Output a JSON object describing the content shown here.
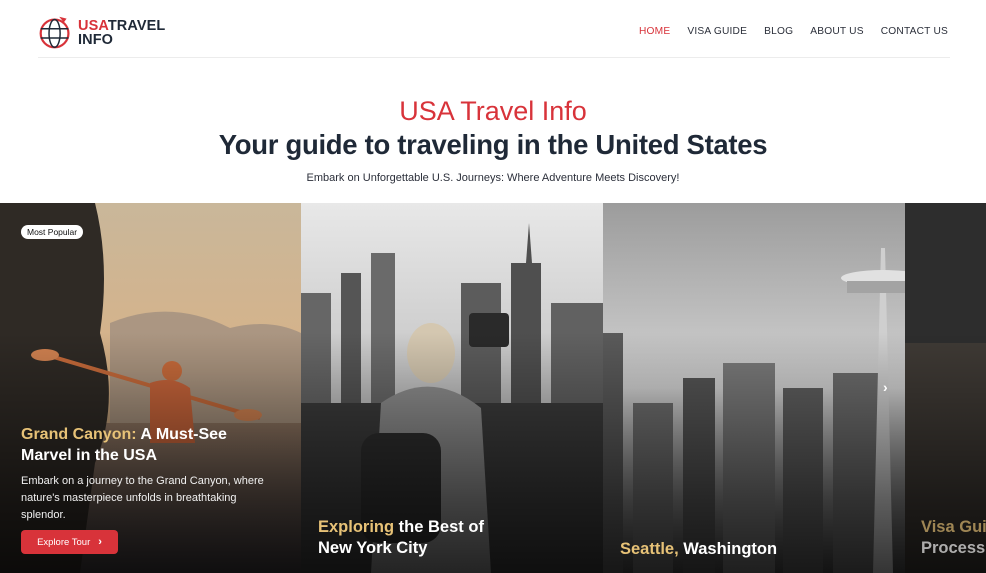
{
  "brand": {
    "name_red": "USA",
    "name_dark": "TRAVEL",
    "name_line2": "INFO"
  },
  "nav": {
    "items": [
      {
        "label": "HOME",
        "active": true
      },
      {
        "label": "VISA GUIDE",
        "active": false
      },
      {
        "label": "BLOG",
        "active": false
      },
      {
        "label": "ABOUT US",
        "active": false
      },
      {
        "label": "CONTACT US",
        "active": false
      }
    ]
  },
  "hero": {
    "title": "USA Travel Info",
    "subtitle": "Your guide to traveling in the United States",
    "tagline": "Embark on Unforgettable U.S. Journeys: Where Adventure Meets Discovery!"
  },
  "cards": [
    {
      "badge": "Most Popular",
      "title_highlight": "Grand Canyon:",
      "title_rest": " A Must-See Marvel in the USA",
      "description": "Embark on a journey to the Grand Canyon, where nature's masterpiece unfolds in breathtaking splendor.",
      "button": "Explore Tour"
    },
    {
      "title_highlight": "Exploring",
      "title_rest": " the Best of New York City"
    },
    {
      "title_highlight": "Seattle,",
      "title_rest": " Washington"
    },
    {
      "title_highlight": "Visa Gui",
      "title_rest": "Process"
    }
  ],
  "colors": {
    "accent": "#d8333a",
    "highlight": "#e7c277",
    "text": "#1f2937"
  },
  "icons": {
    "logo": "globe-icon",
    "button": "chevron-right-icon",
    "slider": "chevron-right-icon"
  }
}
